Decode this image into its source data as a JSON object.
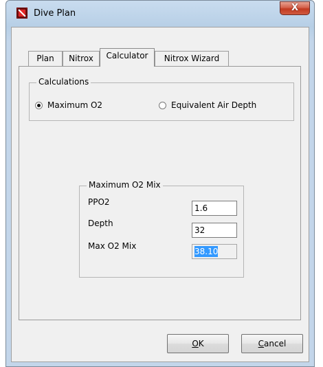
{
  "window": {
    "title": "Dive Plan",
    "close_glyph": "X"
  },
  "tabs": [
    {
      "label": "Plan"
    },
    {
      "label": "Nitrox"
    },
    {
      "label": "Calculator",
      "active": true
    },
    {
      "label": "Nitrox Wizard"
    }
  ],
  "calculations": {
    "legend": "Calculations",
    "options": [
      {
        "label": "Maximum O2",
        "checked": true
      },
      {
        "label": "Equivalent Air Depth",
        "checked": false
      }
    ]
  },
  "max_o2_mix": {
    "legend": "Maximum O2 Mix",
    "ppo2": {
      "label": "PPO2",
      "value": "1.6"
    },
    "depth": {
      "label": "Depth",
      "value": "32"
    },
    "result": {
      "label": "Max O2 Mix",
      "value": "38.10"
    }
  },
  "buttons": {
    "ok_accel": "O",
    "ok_rest": "K",
    "cancel_accel": "C",
    "cancel_rest": "ancel"
  },
  "colors": {
    "title_bar": "#b7cfe6",
    "client": "#f0f0f0",
    "close_button": "#c23a21",
    "selection": "#3399ff"
  },
  "icons": {
    "app": "dive-plan-app-icon",
    "close": "close-icon"
  }
}
